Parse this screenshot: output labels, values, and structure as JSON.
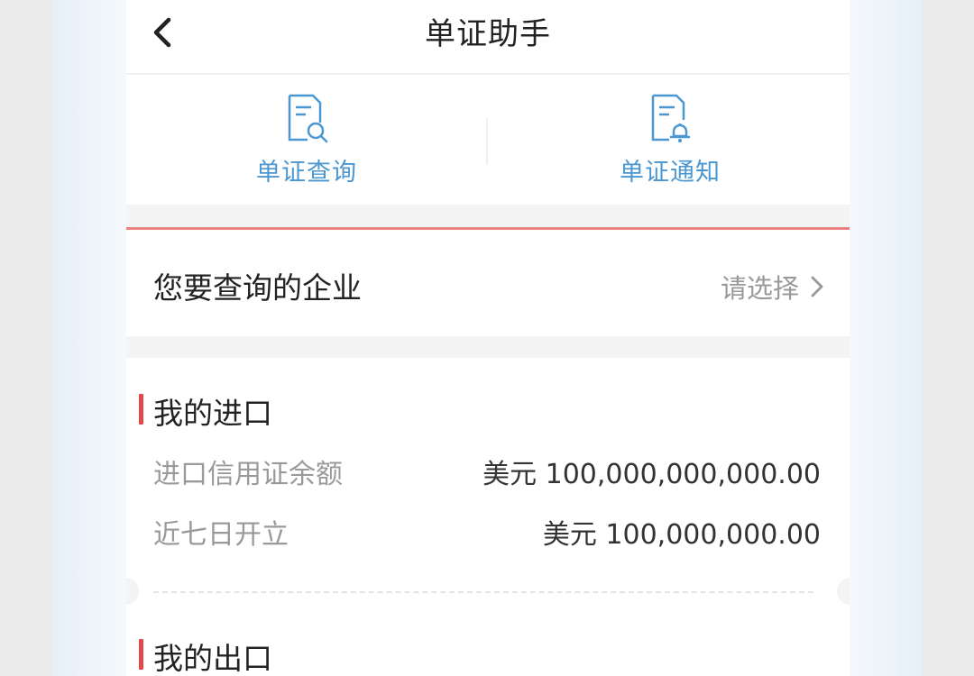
{
  "header": {
    "title": "单证助手",
    "back_icon": "chevron-left-icon"
  },
  "quick_actions": [
    {
      "label": "单证查询",
      "icon": "document-search-icon"
    },
    {
      "label": "单证通知",
      "icon": "document-bell-icon"
    }
  ],
  "company": {
    "label": "您要查询的企业",
    "placeholder": "请选择",
    "arrow_icon": "chevron-right-icon"
  },
  "imports": {
    "title": "我的进口",
    "rows": [
      {
        "label": "进口信用证余额",
        "value": "美元 100,000,000,000.00"
      },
      {
        "label": "近七日开立",
        "value": "美元 100,000,000.00"
      }
    ]
  },
  "exports": {
    "title": "我的出口"
  },
  "colors": {
    "accent_blue": "#4a97d2",
    "accent_red": "#e2494b",
    "divider_red": "#e98181"
  }
}
